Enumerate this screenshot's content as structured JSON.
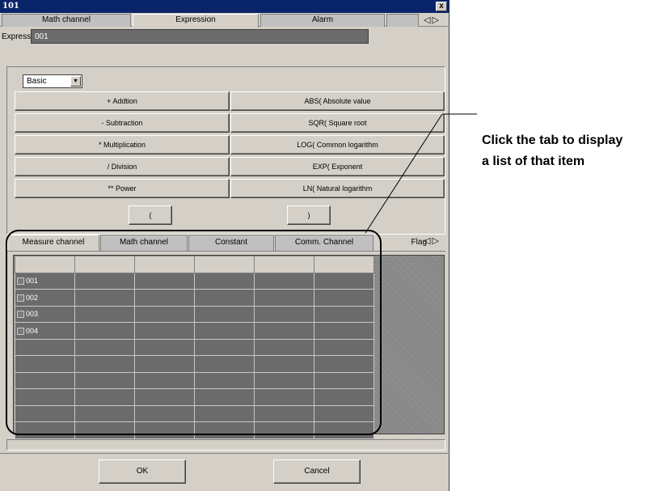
{
  "window": {
    "title": "101",
    "close_label": "x"
  },
  "top_tabs": [
    {
      "label": "Math channel"
    },
    {
      "label": "Expression"
    },
    {
      "label": "Alarm"
    }
  ],
  "expression": {
    "label": "Expression",
    "value": "001"
  },
  "function_group": {
    "selected": "Basic"
  },
  "operator_buttons": {
    "add": "+ Addtion",
    "subtract": "- Subtraction",
    "multiply": "* Multiplication",
    "divide": "/ Division",
    "power": "** Power",
    "abs": "ABS( Absolute value",
    "sqr": "SQR( Square root",
    "log": "LOG( Common logarithm",
    "exp": "EXP( Exponent",
    "ln": "LN( Natural logarithm",
    "open_paren": "(",
    "close_paren": ")"
  },
  "item_tabs": [
    {
      "label": "Measure channel"
    },
    {
      "label": "Math channel"
    },
    {
      "label": "Constant"
    },
    {
      "label": "Comm. Channel"
    },
    {
      "label": "Flag"
    }
  ],
  "channel_rows": [
    "001",
    "002",
    "003",
    "004"
  ],
  "dialog_buttons": {
    "ok": "OK",
    "cancel": "Cancel"
  },
  "annotation": {
    "line1": "Click the tab to display",
    "line2": "a list of that item"
  }
}
